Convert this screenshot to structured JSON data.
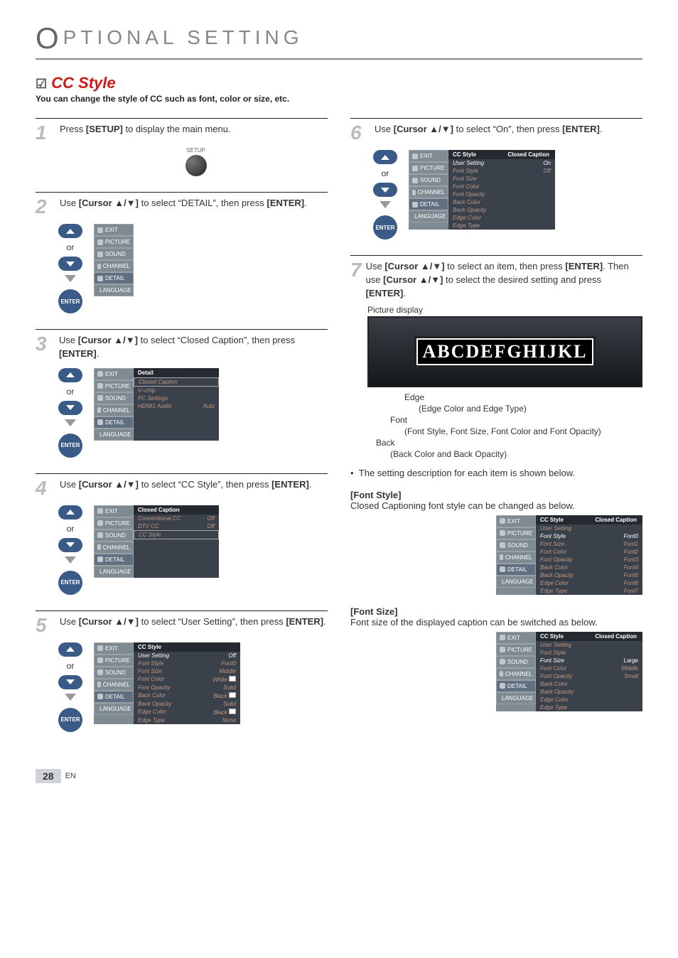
{
  "page_title_rest": "PTIONAL   SETTING",
  "feature": {
    "title": "CC Style",
    "subtitle": "You can change the style of CC such as font, color or size, etc."
  },
  "side_tabs": [
    "EXIT",
    "PICTURE",
    "SOUND",
    "CHANNEL",
    "DETAIL",
    "LANGUAGE"
  ],
  "enter_label": "ENTER",
  "setup_label": "SETUP",
  "or_label": "or",
  "steps": {
    "s1": {
      "num": "1",
      "text_a": "Press ",
      "text_b": "[SETUP]",
      "text_c": " to display the main menu."
    },
    "s2": {
      "num": "2",
      "text_a": "Use ",
      "text_b": "[Cursor ▲/▼]",
      "text_c": " to select “DETAIL”, then press ",
      "text_d": "[ENTER]",
      "text_e": "."
    },
    "s3": {
      "num": "3",
      "text_a": "Use ",
      "text_b": "[Cursor ▲/▼]",
      "text_c": " to select “Closed Caption”, then press ",
      "text_d": "[ENTER]",
      "text_e": ".",
      "menu_title": "Detail",
      "rows": [
        {
          "k": "Closed Caption",
          "v": "",
          "boxed": true
        },
        {
          "k": "V–chip",
          "v": ""
        },
        {
          "k": "PC Settings",
          "v": ""
        },
        {
          "k": "HDMI1 Audio",
          "v": "Auto"
        }
      ]
    },
    "s4": {
      "num": "4",
      "text_a": "Use ",
      "text_b": "[Cursor ▲/▼]",
      "text_c": " to select “CC Style”, then press ",
      "text_d": "[ENTER]",
      "text_e": ".",
      "menu_title": "Closed Caption",
      "rows": [
        {
          "k": "Conventional CC",
          "v": "Off"
        },
        {
          "k": "DTV CC",
          "v": "Off"
        },
        {
          "k": "CC Style",
          "v": "",
          "boxed": true
        }
      ]
    },
    "s5": {
      "num": "5",
      "text_a": "Use ",
      "text_b": "[Cursor ▲/▼]",
      "text_c": " to select “User Setting”, then press ",
      "text_d": "[ENTER]",
      "text_e": ".",
      "menu_title": "CC Style",
      "rows": [
        {
          "k": "User Setting",
          "v": "Off",
          "sel": true
        },
        {
          "k": "Font Style",
          "v": "Font0"
        },
        {
          "k": "Font Size",
          "v": "Middle"
        },
        {
          "k": "Font Color",
          "v": "White",
          "swatch": true
        },
        {
          "k": "Font Opacity",
          "v": "Solid"
        },
        {
          "k": "Back Color",
          "v": "Black",
          "swatch": true
        },
        {
          "k": "Back Opacity",
          "v": "Solid"
        },
        {
          "k": "Edge Color",
          "v": "Black",
          "swatch": true
        },
        {
          "k": "Edge Type",
          "v": "None"
        }
      ]
    },
    "s6": {
      "num": "6",
      "text_a": "Use ",
      "text_b": "[Cursor ▲/▼]",
      "text_c": " to select “On”, then press ",
      "text_d": "[ENTER]",
      "text_e": ".",
      "menu_title": "CC Style",
      "menu_right": "Closed Caption",
      "rows": [
        {
          "k": "User Setting",
          "v": "On",
          "sel": true
        },
        {
          "k": "Font Style",
          "v": "Off"
        },
        {
          "k": "Font Size",
          "v": ""
        },
        {
          "k": "Font Color",
          "v": ""
        },
        {
          "k": "Font Opacity",
          "v": ""
        },
        {
          "k": "Back Color",
          "v": ""
        },
        {
          "k": "Back Opacity",
          "v": ""
        },
        {
          "k": "Edge Color",
          "v": ""
        },
        {
          "k": "Edge Type",
          "v": ""
        }
      ]
    },
    "s7": {
      "num": "7",
      "text_a": "Use ",
      "text_b": "[Cursor ▲/▼]",
      "text_c": " to select an item, then press ",
      "text_d": "[ENTER]",
      "text_e": ". Then use ",
      "text_f": "[Cursor ▲/▼]",
      "text_g": " to select the desired setting and press ",
      "text_h": "[ENTER]",
      "text_i": "."
    }
  },
  "picture_display": {
    "label": "Picture display",
    "sample": "ABCDEFGHIJKL",
    "edge_label": "Edge",
    "edge_desc": "(Edge Color and Edge Type)",
    "font_label": "Font",
    "font_desc": "(Font Style, Font Size, Font Color and Font Opacity)",
    "back_label": "Back",
    "back_desc": "(Back Color and Back Opacity)"
  },
  "bullet_note": "The setting description for each item is shown below.",
  "font_style": {
    "head": "[Font Style]",
    "desc": "Closed Captioning font style can be changed as below.",
    "menu_title": "CC Style",
    "menu_right": "Closed Caption",
    "rows": [
      {
        "k": "User Setting",
        "v": ""
      },
      {
        "k": "Font Style",
        "v": "Font0",
        "sel": true
      },
      {
        "k": "Font Size",
        "v": "Font1"
      },
      {
        "k": "Font Color",
        "v": "Font2"
      },
      {
        "k": "Font Opacity",
        "v": "Font3"
      },
      {
        "k": "Back Color",
        "v": "Font4"
      },
      {
        "k": "Back Opacity",
        "v": "Font5"
      },
      {
        "k": "Edge Color",
        "v": "Font6"
      },
      {
        "k": "Edge Type",
        "v": "Font7"
      }
    ]
  },
  "font_size": {
    "head": "[Font Size]",
    "desc": "Font size of the displayed caption can be switched as below.",
    "menu_title": "CC Style",
    "menu_right": "Closed Caption",
    "rows": [
      {
        "k": "User Setting",
        "v": ""
      },
      {
        "k": "Font Style",
        "v": ""
      },
      {
        "k": "Font Size",
        "v": "Large",
        "sel": true
      },
      {
        "k": "Font Color",
        "v": "Middle"
      },
      {
        "k": "Font Opacity",
        "v": "Small"
      },
      {
        "k": "Back Color",
        "v": ""
      },
      {
        "k": "Back Opacity",
        "v": ""
      },
      {
        "k": "Edge Color",
        "v": ""
      },
      {
        "k": "Edge Type",
        "v": ""
      }
    ]
  },
  "footer": {
    "page": "28",
    "lang": "EN"
  }
}
